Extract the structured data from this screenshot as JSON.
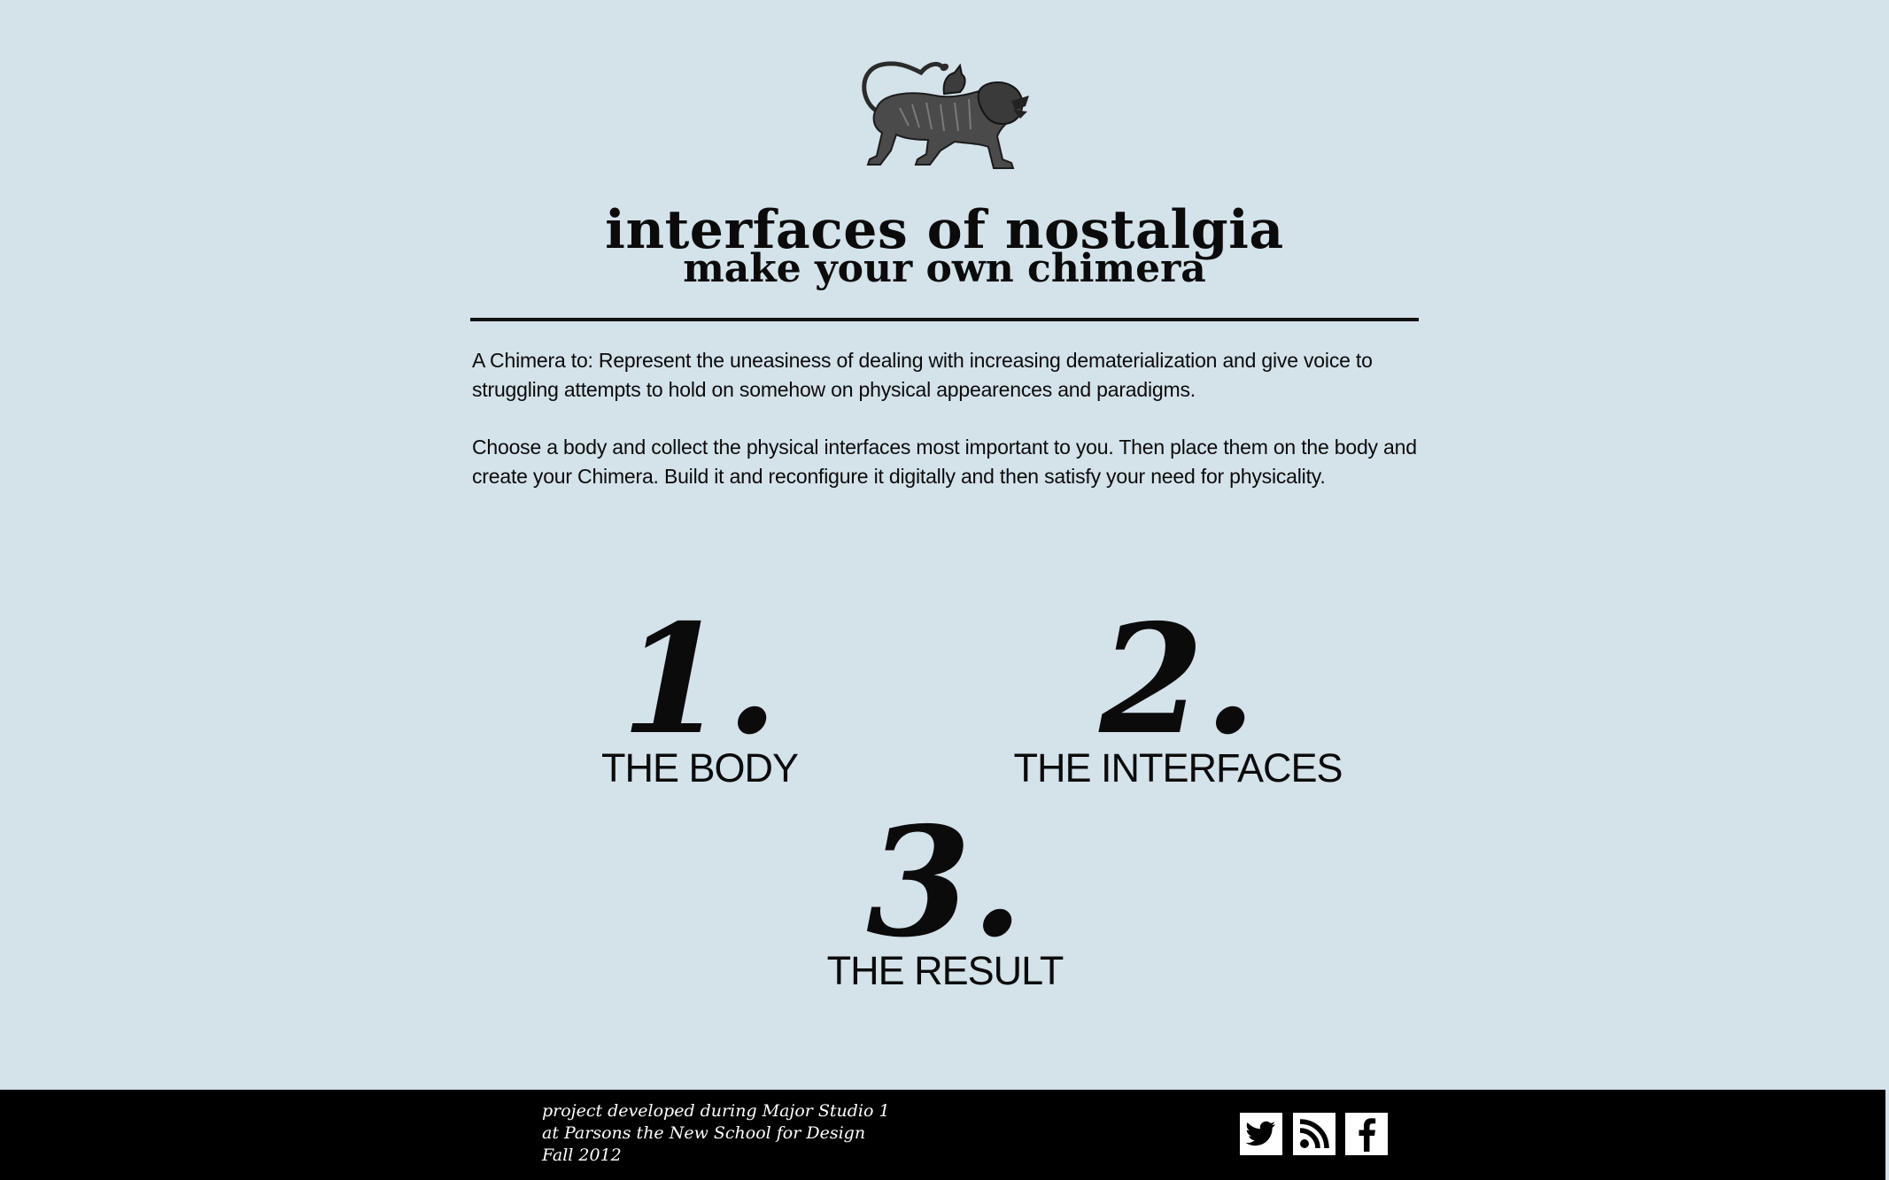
{
  "header": {
    "logo_icon": "chimera-icon",
    "title": "interfaces of nostalgia",
    "subtitle": "make your own chimera"
  },
  "intro": {
    "paragraph_1": " A Chimera to: Represent the uneasiness of dealing with increasing dematerialization and give voice to struggling attempts to hold on somehow on physical appearences and paradigms.",
    "paragraph_2": "Choose a body and collect the physical interfaces most important to you. Then place them on the body and create your Chimera. Build it and reconfigure it digitally and then satisfy your need for physicality."
  },
  "steps": [
    {
      "number": "1.",
      "label": "THE BODY"
    },
    {
      "number": "2.",
      "label": "THE INTERFACES"
    },
    {
      "number": "3.",
      "label": "THE RESULT"
    }
  ],
  "footer": {
    "lines": [
      "project developed during Major Studio 1",
      "at Parsons the New School for Design",
      "Fall 2012"
    ],
    "social": [
      {
        "icon": "twitter-icon"
      },
      {
        "icon": "rss-icon"
      },
      {
        "icon": "facebook-icon"
      }
    ]
  },
  "colors": {
    "background": "#d4e2ea",
    "text": "#0b0b0b",
    "footer_background": "#000000",
    "footer_text": "#ffffff"
  }
}
